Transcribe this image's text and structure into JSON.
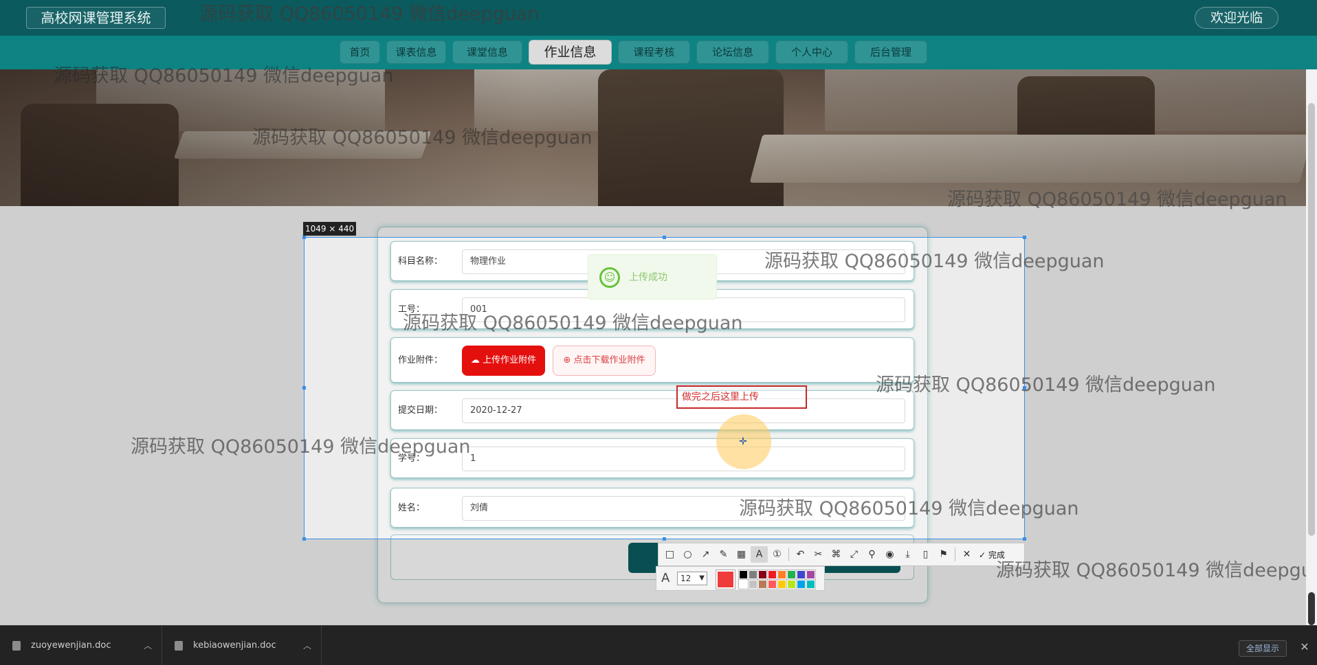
{
  "header": {
    "site_title": "高校网课管理系统",
    "welcome": "欢迎光临"
  },
  "nav": [
    {
      "label": "首页"
    },
    {
      "label": "课表信息"
    },
    {
      "label": "课堂信息"
    },
    {
      "label": "作业信息",
      "active": true
    },
    {
      "label": "课程考核"
    },
    {
      "label": "论坛信息"
    },
    {
      "label": "个人中心"
    },
    {
      "label": "后台管理"
    }
  ],
  "form": {
    "subject_label": "科目名称：",
    "subject_value": "物理作业",
    "staff_label": "工号：",
    "staff_value": "001",
    "attach_label": "作业附件：",
    "upload_btn": "上传作业附件",
    "download_btn": "点击下载作业附件",
    "date_label": "提交日期：",
    "date_value": "2020-12-27",
    "sid_label": "学号：",
    "sid_value": "1",
    "name_label": "姓名：",
    "name_value": "刘倩"
  },
  "toast": {
    "message": "上传成功",
    "icon": "smile-icon"
  },
  "capture": {
    "size_label": "1049 × 440",
    "annotation_text": "做完之后这里上传",
    "done_label": "完成",
    "font_size": "12",
    "current_color": "#ef3b3b",
    "swatches": [
      "#000000",
      "#7f7f7f",
      "#880015",
      "#ed1c24",
      "#ff7f27",
      "#22b14c",
      "#3f48cc",
      "#a349a4",
      "#ffffff",
      "#c3c3c3",
      "#b97a57",
      "#ff5a5a",
      "#ffc90e",
      "#b5e61d",
      "#00a2e8",
      "#00bcbc"
    ],
    "tools": [
      "rect-icon",
      "ellipse-icon",
      "arrow-icon",
      "pen-icon",
      "mosaic-icon",
      "text-icon",
      "number-icon",
      "undo-icon",
      "scissors-icon",
      "ocr-icon",
      "expand-icon",
      "pin-icon",
      "record-icon",
      "save-icon",
      "phone-icon",
      "bookmark-icon",
      "close-icon",
      "check-icon"
    ]
  },
  "watermark": "源码获取 QQ86050149 微信deepguan",
  "downloads": [
    {
      "file": "zuoyewenjian.doc"
    },
    {
      "file": "kebiaowenjian.doc"
    }
  ],
  "shelf": {
    "show_all": "全部显示"
  }
}
